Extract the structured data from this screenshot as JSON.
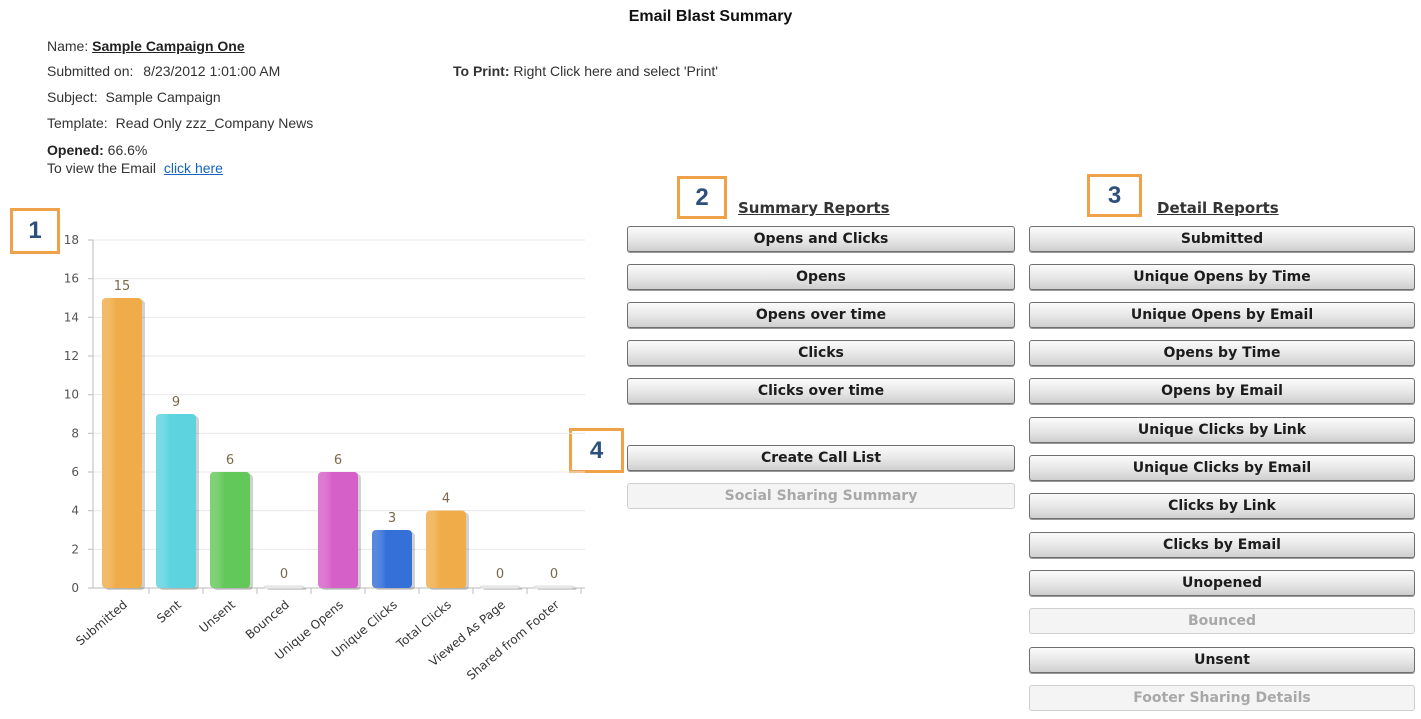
{
  "page": {
    "title": "Email Blast Summary"
  },
  "info": {
    "name_label": "Name:",
    "name_value": "Sample Campaign One",
    "submitted_label": "Submitted on:",
    "submitted_value": "8/23/2012 1:01:00 AM",
    "subject_label": "Subject:",
    "subject_value": "Sample Campaign",
    "template_label": "Template:",
    "template_value": "Read Only zzz_Company News",
    "opened_label": "Opened:",
    "opened_value": "66.6%",
    "view_label": "To view the Email",
    "view_link": "click here"
  },
  "print": {
    "label": "To Print:",
    "text": "Right Click here and select 'Print'"
  },
  "callouts": [
    "1",
    "2",
    "3",
    "4"
  ],
  "summary": {
    "heading": "Summary Reports",
    "buttons": [
      "Opens and Clicks",
      "Opens",
      "Opens over time",
      "Clicks",
      "Clicks over time"
    ],
    "call_list": "Create Call List",
    "social": "Social Sharing Summary"
  },
  "detail": {
    "heading": "Detail Reports",
    "buttons": [
      {
        "label": "Submitted",
        "enabled": true
      },
      {
        "label": "Unique Opens by Time",
        "enabled": true
      },
      {
        "label": "Unique Opens by Email",
        "enabled": true
      },
      {
        "label": "Opens by Time",
        "enabled": true
      },
      {
        "label": "Opens by Email",
        "enabled": true
      },
      {
        "label": "Unique Clicks by Link",
        "enabled": true
      },
      {
        "label": "Unique Clicks by Email",
        "enabled": true
      },
      {
        "label": "Clicks by Link",
        "enabled": true
      },
      {
        "label": "Clicks by Email",
        "enabled": true
      },
      {
        "label": "Unopened",
        "enabled": true
      },
      {
        "label": "Bounced",
        "enabled": false
      },
      {
        "label": "Unsent",
        "enabled": true
      },
      {
        "label": "Footer Sharing Details",
        "enabled": false
      }
    ]
  },
  "chart_data": {
    "type": "bar",
    "categories": [
      "Submitted",
      "Sent",
      "Unsent",
      "Bounced",
      "Unique Opens",
      "Unique Clicks",
      "Total Clicks",
      "Viewed As Page",
      "Shared from Footer"
    ],
    "values": [
      15,
      9,
      6,
      0,
      6,
      3,
      4,
      0,
      0
    ],
    "colors": [
      "#f0ac48",
      "#5cd3df",
      "#63c85a",
      "#f0ac48",
      "#d560c8",
      "#3570d8",
      "#f0ac48",
      "#f0ac48",
      "#f0ac48"
    ],
    "yticks": [
      "0",
      "2",
      "4",
      "6",
      "8",
      "10",
      "12",
      "14",
      "16",
      "18"
    ],
    "ylim": [
      0,
      18
    ],
    "grid": true
  }
}
